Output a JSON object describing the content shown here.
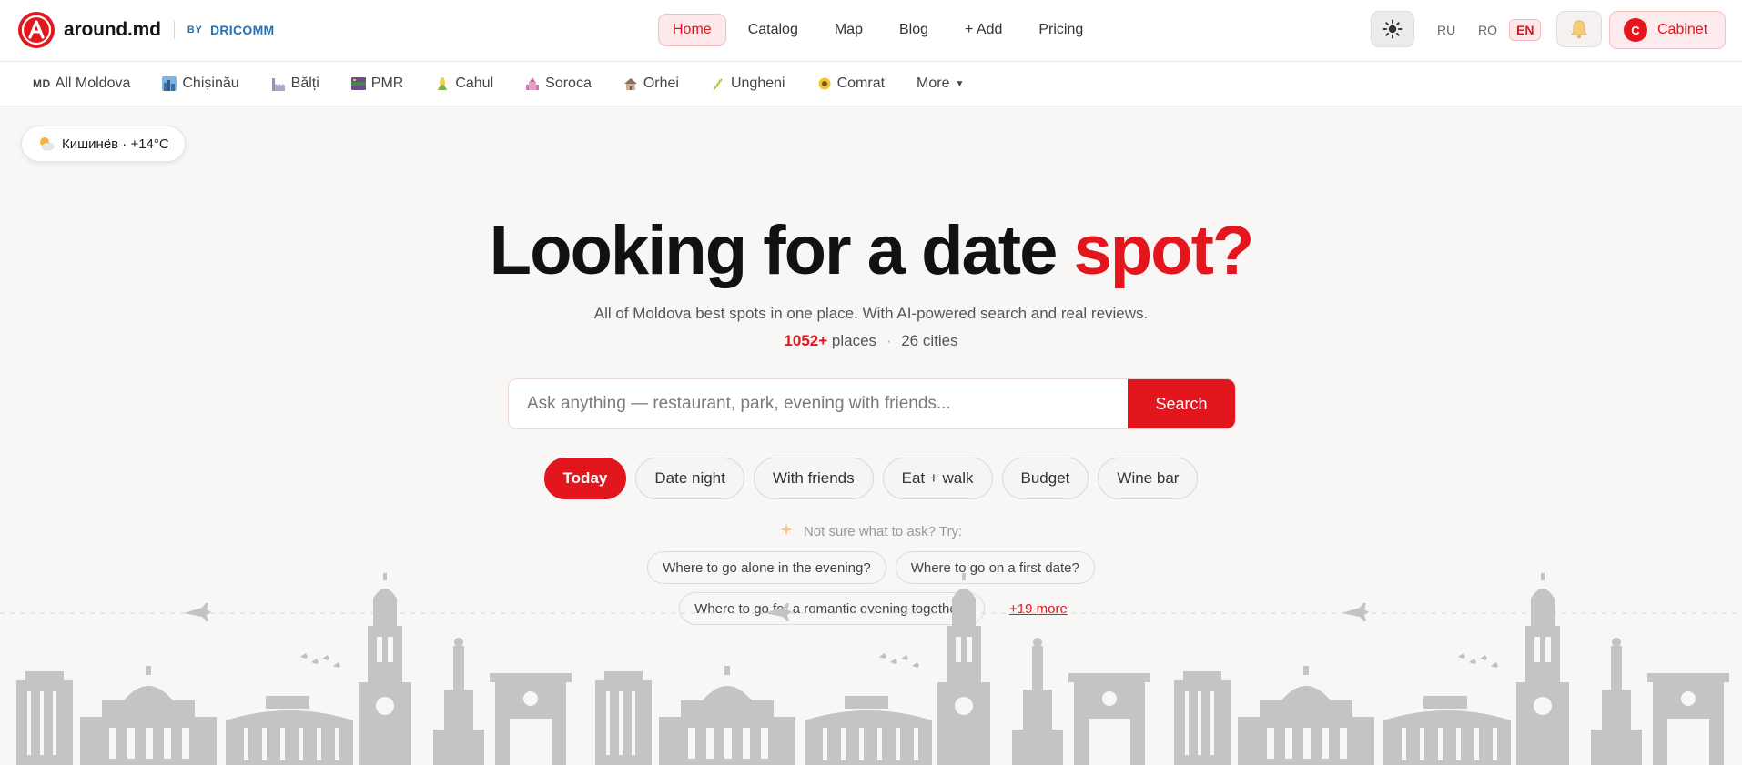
{
  "header": {
    "brand": "around.md",
    "by_label": "BY",
    "by_brand": "DRICOMM",
    "nav": [
      {
        "label": "Home",
        "active": true
      },
      {
        "label": "Catalog",
        "active": false
      },
      {
        "label": "Map",
        "active": false
      },
      {
        "label": "Blog",
        "active": false
      },
      {
        "label": "+ Add",
        "active": false
      },
      {
        "label": "Pricing",
        "active": false
      }
    ],
    "theme_icon": "sun-icon",
    "languages": [
      {
        "code": "RU",
        "active": false
      },
      {
        "code": "RO",
        "active": false
      },
      {
        "code": "EN",
        "active": true
      }
    ],
    "notifications_icon": "bell-icon",
    "cabinet": {
      "avatar_letter": "C",
      "label": "Cabinet"
    }
  },
  "cities": [
    {
      "code": "MD",
      "label": "All Moldova"
    },
    {
      "label": "Chișinău",
      "icon": "city-skyline-icon"
    },
    {
      "label": "Bălți",
      "icon": "factory-icon"
    },
    {
      "label": "PMR",
      "icon": "flag-icon"
    },
    {
      "label": "Cahul",
      "icon": "corn-icon"
    },
    {
      "label": "Soroca",
      "icon": "fortress-icon"
    },
    {
      "label": "Orhei",
      "icon": "monastery-icon"
    },
    {
      "label": "Ungheni",
      "icon": "grain-icon"
    },
    {
      "label": "Comrat",
      "icon": "sunflower-icon"
    }
  ],
  "more_cities_label": "More",
  "weather": {
    "text": "Кишинёв · +14°C",
    "icon": "sun-behind-cloud-icon"
  },
  "hero": {
    "title_main": "Looking for a date ",
    "title_accent": "spot?",
    "subtitle": "All of Moldova best spots in one place. With AI-powered search and real reviews.",
    "places_count": "1052+",
    "places_label": "places",
    "cities_label": "26 cities"
  },
  "search": {
    "placeholder": "Ask anything — restaurant, park, evening with friends...",
    "button": "Search"
  },
  "chips": [
    {
      "label": "Today",
      "active": true
    },
    {
      "label": "Date night",
      "active": false
    },
    {
      "label": "With friends",
      "active": false
    },
    {
      "label": "Eat + walk",
      "active": false
    },
    {
      "label": "Budget",
      "active": false
    },
    {
      "label": "Wine bar",
      "active": false
    }
  ],
  "hint": "Not sure what to ask? Try:",
  "suggestions": [
    "Where to go alone in the evening?",
    "Where to go on a first date?",
    "Where to go for a romantic evening together?"
  ],
  "more_suggestions": "+19 more",
  "colors": {
    "accent": "#e3161e",
    "link_blue": "#1e73be",
    "background": "#f8f7f5",
    "skyline": "#c4c4c4"
  }
}
